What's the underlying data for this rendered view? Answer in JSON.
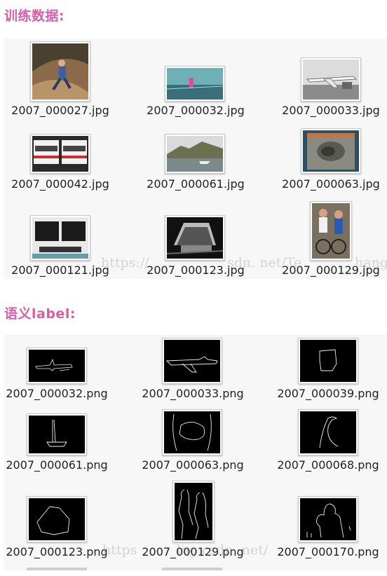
{
  "section1": {
    "title": "训练数据:",
    "files": [
      "2007_000027.jpg",
      "2007_000032.jpg",
      "2007_000033.jpg",
      "2007_000042.jpg",
      "2007_000061.jpg",
      "2007_000063.jpg",
      "2007_000121.jpg",
      "2007_000123.jpg",
      "2007_000129.jpg"
    ]
  },
  "section2": {
    "title": "语义label:",
    "files": [
      "2007_000032.png",
      "2007_000033.png",
      "2007_000039.png",
      "2007_000061.png",
      "2007_000063.png",
      "2007_000068.png",
      "2007_000123.png",
      "2007_000129.png",
      "2007_000170.png"
    ]
  },
  "watermark": "https://blog.csdn.net/TeFuirnever",
  "watermark_fragments": [
    "https://",
    "sdn. net/Te",
    "hang",
    "https",
    "log.csdn. net/"
  ],
  "colors": {
    "heading": "#d75fa8",
    "panel": "#f7f7f7"
  }
}
